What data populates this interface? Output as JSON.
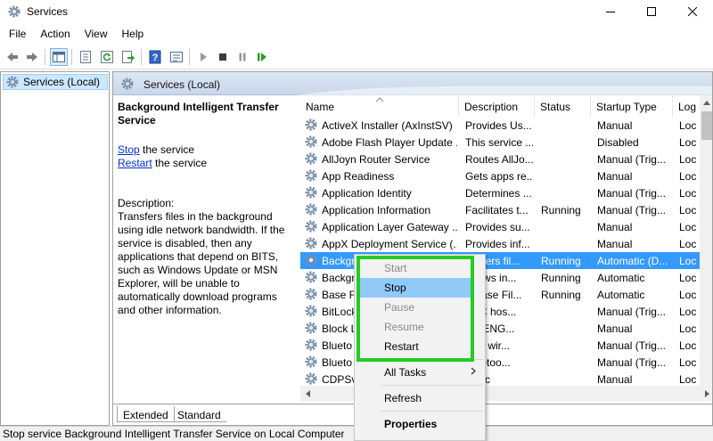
{
  "window": {
    "title": "Services",
    "app_icon": "gear-icon",
    "controls": [
      "minimize-icon",
      "maximize-icon",
      "close-icon"
    ]
  },
  "menu": [
    {
      "label": "File"
    },
    {
      "label": "Action"
    },
    {
      "label": "View"
    },
    {
      "label": "Help"
    }
  ],
  "toolbar": {
    "icons": [
      "back-icon",
      "forward-icon",
      "console-tree-icon",
      "properties-icon",
      "refresh-icon",
      "export-icon",
      "help-icon",
      "details-icon",
      "start-icon",
      "stop-icon",
      "pause-icon",
      "restart-icon"
    ]
  },
  "tree": {
    "item_label": "Services (Local)"
  },
  "main": {
    "header_title": "Services (Local)",
    "service_name": "Background Intelligent Transfer Service",
    "stop_link": "Stop",
    "stop_suffix": " the service",
    "restart_link": "Restart",
    "restart_suffix": " the service",
    "description_label": "Description:",
    "description_text": "Transfers files in the background using idle network bandwidth. If the service is disabled, then any applications that depend on BITS, such as Windows Update or MSN Explorer, will be unable to automatically download programs and other information."
  },
  "columns": [
    "Name",
    "Description",
    "Status",
    "Startup Type",
    "Log"
  ],
  "rows": [
    {
      "name": "ActiveX Installer (AxInstSV)",
      "description": "Provides Us...",
      "status": "",
      "startup": "Manual",
      "log": "Loc"
    },
    {
      "name": "Adobe Flash Player Update ...",
      "description": "This service ...",
      "status": "",
      "startup": "Disabled",
      "log": "Loc"
    },
    {
      "name": "AllJoyn Router Service",
      "description": "Routes AllJo...",
      "status": "",
      "startup": "Manual (Trig...",
      "log": "Loc"
    },
    {
      "name": "App Readiness",
      "description": "Gets apps re...",
      "status": "",
      "startup": "Manual",
      "log": "Loc"
    },
    {
      "name": "Application Identity",
      "description": "Determines ...",
      "status": "",
      "startup": "Manual (Trig...",
      "log": "Loc"
    },
    {
      "name": "Application Information",
      "description": "Facilitates t...",
      "status": "Running",
      "startup": "Manual (Trig...",
      "log": "Loc"
    },
    {
      "name": "Application Layer Gateway ...",
      "description": "Provides su...",
      "status": "",
      "startup": "Manual",
      "log": "Loc"
    },
    {
      "name": "AppX Deployment Service (...",
      "description": "Provides inf...",
      "status": "",
      "startup": "Manual",
      "log": "Loc"
    },
    {
      "name": "Backgr",
      "description": "ansfers fil...",
      "status": "Running",
      "startup": "Automatic (D...",
      "log": "Loc",
      "selected": true
    },
    {
      "name": "Backgr",
      "description": "ndows in...",
      "status": "Running",
      "startup": "Automatic",
      "log": "Loc"
    },
    {
      "name": "Base Fi",
      "description": "e Base Fil...",
      "status": "Running",
      "startup": "Automatic",
      "log": "Loc"
    },
    {
      "name": "BitLock",
      "description": "SVC hos...",
      "status": "",
      "startup": "Manual (Trig...",
      "log": "Loc"
    },
    {
      "name": "Block L",
      "description": "WBENG...",
      "status": "",
      "startup": "Manual",
      "log": "Loc"
    },
    {
      "name": "Blueto",
      "description": "bles wir...",
      "status": "",
      "startup": "Manual (Trig...",
      "log": "Loc"
    },
    {
      "name": "Blueto",
      "description": "Bluetoo...",
      "status": "",
      "startup": "Manual (Trig...",
      "log": "Loc"
    },
    {
      "name": "CDPSv",
      "description": "PSvc",
      "status": "",
      "startup": "Manual",
      "log": "Loc"
    }
  ],
  "tabs": [
    {
      "label": "Extended"
    },
    {
      "label": "Standard"
    }
  ],
  "status_bar": "Stop service Background Intelligent Transfer Service on Local Computer",
  "context_menu": {
    "items": [
      {
        "label": "Start",
        "state": "disabled"
      },
      {
        "label": "Stop",
        "state": "hover"
      },
      {
        "label": "Pause",
        "state": "disabled"
      },
      {
        "label": "Resume",
        "state": "disabled"
      },
      {
        "label": "Restart",
        "state": "enabled"
      },
      {
        "label": "All Tasks",
        "state": "submenu"
      },
      {
        "label": "Refresh",
        "state": "enabled"
      },
      {
        "label": "Properties",
        "state": "bold"
      }
    ]
  },
  "colors": {
    "selection": "#3399ff",
    "highlight_box": "#22cc22",
    "menu_hover": "#91c9f7",
    "link": "#0033cc"
  }
}
